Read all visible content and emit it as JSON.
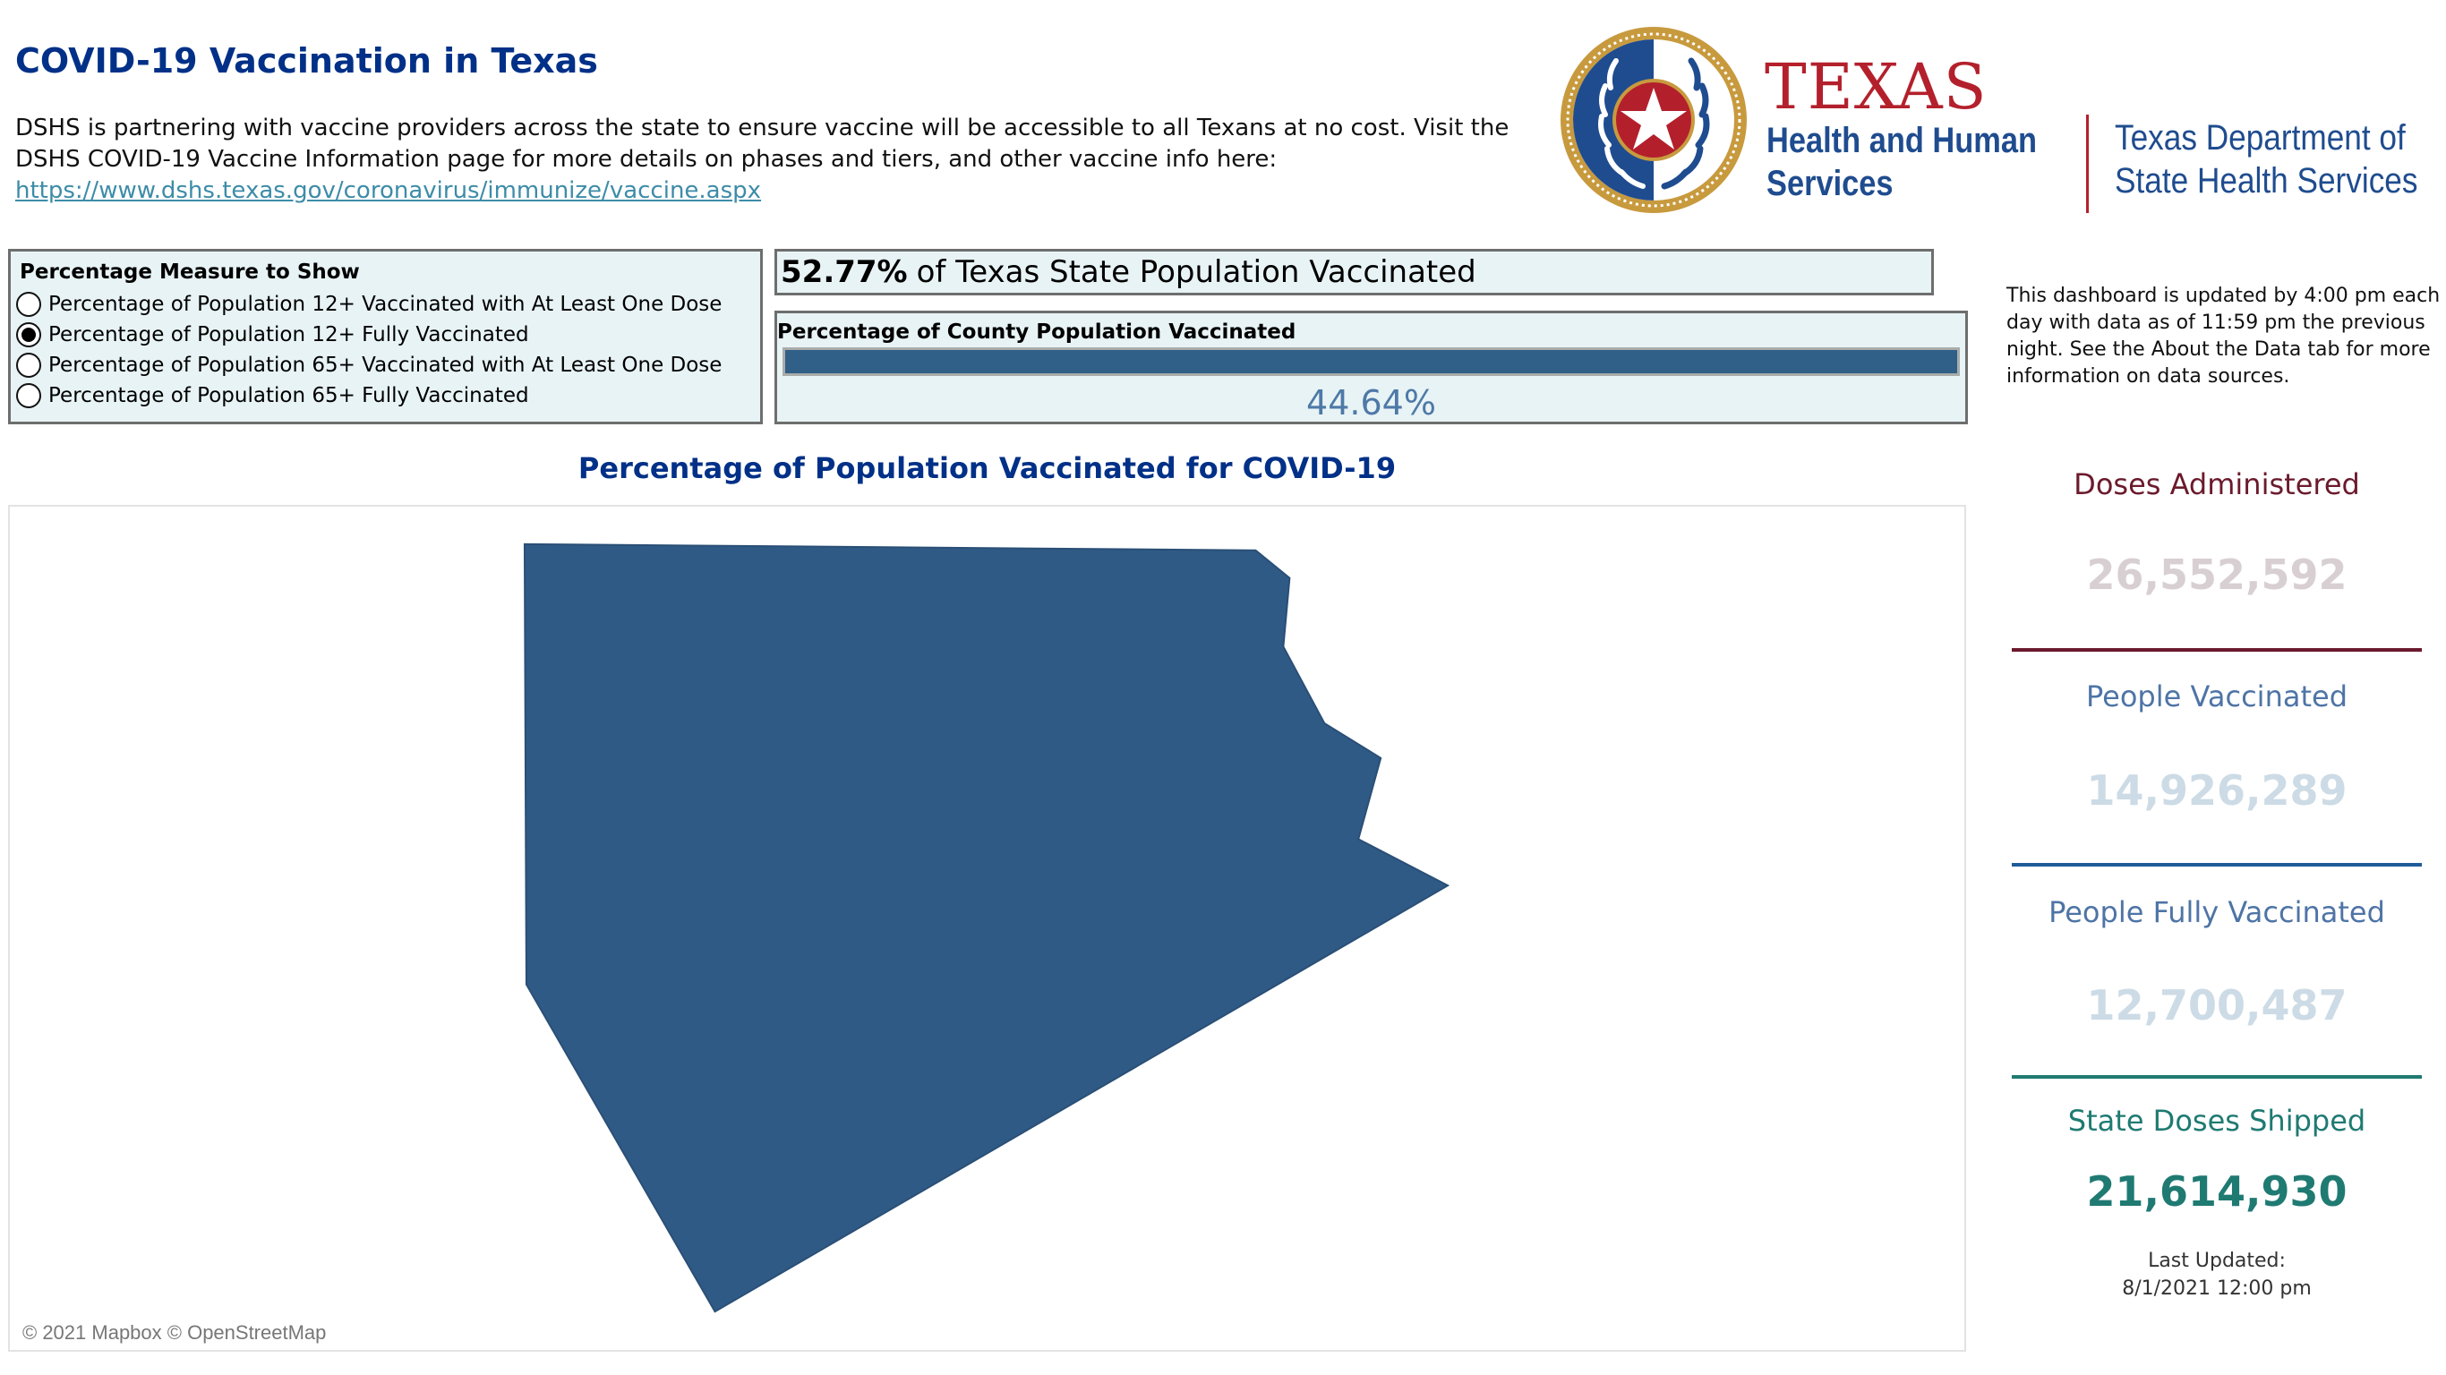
{
  "header": {
    "title": "COVID-19 Vaccination in Texas",
    "intro_line1": "DSHS is partnering with vaccine providers across the state to ensure vaccine will be accessible to all Texans at no cost. Visit the",
    "intro_line2": "DSHS COVID-19 Vaccine Information page for more details on phases and tiers, and other vaccine info here:",
    "link_text": "https://www.dshs.texas.gov/coronavirus/immunize/vaccine.aspx"
  },
  "logo": {
    "icon": "texas-seal-icon",
    "hhs_word": "TEXAS",
    "hhs_line1": "Health and Human",
    "hhs_line2": "Services",
    "dshs_line1": "Texas Department of",
    "dshs_line2": "State Health Services"
  },
  "filter": {
    "title": "Percentage Measure to Show",
    "options": [
      {
        "label": "Percentage of Population 12+ Vaccinated with At Least One Dose",
        "selected": false
      },
      {
        "label": "Percentage of Population 12+ Fully Vaccinated",
        "selected": true
      },
      {
        "label": "Percentage of Population 65+ Vaccinated with At Least One Dose",
        "selected": false
      },
      {
        "label": "Percentage of Population 65+ Fully Vaccinated",
        "selected": false
      }
    ]
  },
  "state_summary": {
    "percent": "52.77%",
    "label": "of Texas State Population Vaccinated"
  },
  "county_summary": {
    "title": "Percentage of County Population Vaccinated",
    "value": "44.64%",
    "bar_color": "#305f88"
  },
  "info": {
    "text": "This dashboard is updated by 4:00 pm each day with data as of 11:59 pm the previous night. See the About the Data tab for more information on data sources."
  },
  "map": {
    "title": "Percentage of Population Vaccinated for COVID-19",
    "attribution": "© 2021 Mapbox © OpenStreetMap",
    "region_color": "#2f5a85"
  },
  "stats": [
    {
      "label": "Doses Administered",
      "value": "26,552,592",
      "label_color": "#6b1a2c",
      "value_color": "#d8cfd3",
      "line_color": "#6b1a2c"
    },
    {
      "label": "People Vaccinated",
      "value": "14,926,289",
      "label_color": "#4e74a6",
      "value_color": "#ccdbe5",
      "line_color": "#1f5c99"
    },
    {
      "label": "People Fully Vaccinated",
      "value": "12,700,487",
      "label_color": "#4e74a6",
      "value_color": "#ccdbe5",
      "line_color": "#1f7a72"
    },
    {
      "label": "State Doses Shipped",
      "value": "21,614,930",
      "label_color": "#1f7a72",
      "value_color": "#1f7a72"
    }
  ],
  "last_updated": {
    "label": "Last Updated:",
    "value": "8/1/2021 12:00 pm"
  }
}
